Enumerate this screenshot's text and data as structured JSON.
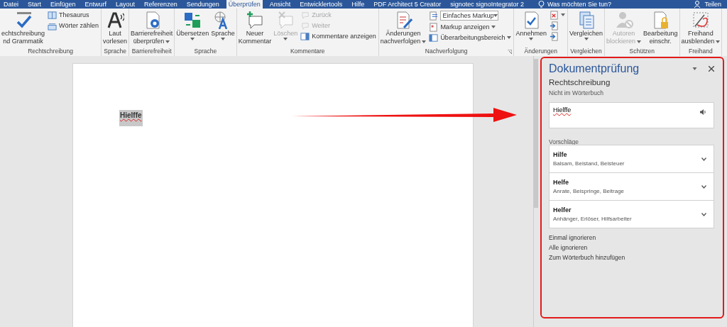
{
  "tabs": [
    {
      "label": "Datei",
      "selected": false
    },
    {
      "label": "Start",
      "selected": false
    },
    {
      "label": "Einfügen",
      "selected": false
    },
    {
      "label": "Entwurf",
      "selected": false
    },
    {
      "label": "Layout",
      "selected": false
    },
    {
      "label": "Referenzen",
      "selected": false
    },
    {
      "label": "Sendungen",
      "selected": false
    },
    {
      "label": "Überprüfen",
      "selected": true
    },
    {
      "label": "Ansicht",
      "selected": false
    },
    {
      "label": "Entwicklertools",
      "selected": false
    },
    {
      "label": "Hilfe",
      "selected": false
    },
    {
      "label": "PDF Architect 5 Creator",
      "selected": false
    },
    {
      "label": "signotec signoIntegrator 2",
      "selected": false
    }
  ],
  "tell_me": {
    "placeholder": "Was möchten Sie tun?"
  },
  "share": {
    "label": "Teilen"
  },
  "ribbon": {
    "groups": [
      {
        "label": "Rechtschreibung",
        "items": [
          {
            "kind": "large",
            "lines": [
              "echtschreibung",
              "nd Grammatik"
            ],
            "disabled": false,
            "dropdown": false
          },
          {
            "kind": "stack",
            "items": [
              {
                "label": "Thesaurus",
                "disabled": false,
                "dropdown": false
              },
              {
                "label": "Wörter zählen",
                "disabled": false,
                "dropdown": false
              }
            ]
          }
        ]
      },
      {
        "label": "Sprache",
        "items": [
          {
            "kind": "large",
            "lines": [
              "Laut",
              "vorlesen"
            ],
            "disabled": false,
            "dropdown": false
          }
        ]
      },
      {
        "label": "Barrierefreiheit",
        "items": [
          {
            "kind": "large",
            "lines": [
              "Barrierefreiheit",
              "überprüfen"
            ],
            "disabled": false,
            "dropdown": true
          }
        ]
      },
      {
        "label": "Sprache",
        "items": [
          {
            "kind": "large",
            "lines": [
              "Übersetzen"
            ],
            "disabled": false,
            "dropdown": true
          },
          {
            "kind": "large",
            "lines": [
              "Sprache"
            ],
            "disabled": false,
            "dropdown": true
          }
        ]
      },
      {
        "label": "Kommentare",
        "items": [
          {
            "kind": "large",
            "lines": [
              "Neuer",
              "Kommentar"
            ],
            "disabled": false,
            "dropdown": false
          },
          {
            "kind": "large",
            "lines": [
              "Löschen"
            ],
            "disabled": true,
            "dropdown": true
          },
          {
            "kind": "stack",
            "items": [
              {
                "label": "Zurück",
                "disabled": true,
                "dropdown": false
              },
              {
                "label": "Weiter",
                "disabled": true,
                "dropdown": false
              },
              {
                "label": "Kommentare anzeigen",
                "disabled": false,
                "dropdown": false
              }
            ]
          }
        ]
      },
      {
        "label": "Nachverfolgung",
        "launcher": true,
        "items": [
          {
            "kind": "large",
            "lines": [
              "Änderungen",
              "nachverfolgen"
            ],
            "disabled": false,
            "dropdown": true
          },
          {
            "kind": "stack",
            "items": [
              {
                "kind": "combo",
                "label": "Einfaches Markup",
                "dropdown": true
              },
              {
                "label": "Markup anzeigen",
                "disabled": false,
                "dropdown": true
              },
              {
                "label": "Überarbeitungsbereich",
                "disabled": false,
                "dropdown": true
              }
            ]
          }
        ]
      },
      {
        "label": "Änderungen",
        "items": [
          {
            "kind": "large",
            "lines": [
              "Annehmen"
            ],
            "disabled": false,
            "dropdown": true
          },
          {
            "kind": "stack",
            "items": [
              {
                "disabled": false,
                "dropdown": true
              },
              {
                "disabled": false,
                "dropdown": false
              },
              {
                "disabled": false,
                "dropdown": false
              }
            ]
          }
        ]
      },
      {
        "label": "Vergleichen",
        "items": [
          {
            "kind": "large",
            "lines": [
              "Vergleichen"
            ],
            "disabled": false,
            "dropdown": true
          }
        ]
      },
      {
        "label": "Schützen",
        "items": [
          {
            "kind": "large",
            "lines": [
              "Autoren",
              "blockieren"
            ],
            "disabled": true,
            "dropdown": true
          },
          {
            "kind": "large",
            "lines": [
              "Bearbeitung",
              "einschr."
            ],
            "disabled": false,
            "dropdown": false
          }
        ]
      },
      {
        "label": "Freihand",
        "items": [
          {
            "kind": "large",
            "lines": [
              "Freihand",
              "ausblenden"
            ],
            "disabled": false,
            "dropdown": true
          }
        ]
      }
    ]
  },
  "document": {
    "misspelled_word": "Hielffe"
  },
  "pane": {
    "title": "Dokumentprüfung",
    "section": "Rechtschreibung",
    "reason": "Nicht im Wörterbuch",
    "word": "Hielffe",
    "suggestions_label": "Vorschläge",
    "suggestions": [
      {
        "word": "Hilfe",
        "synonyms": "Balsam, Beistand, Beisteuer"
      },
      {
        "word": "Helfe",
        "synonyms": "Anrate, Beispringe, Beitrage"
      },
      {
        "word": "Helfer",
        "synonyms": "Anhänger, Erlöser, Hilfsarbeiter"
      }
    ],
    "actions": [
      "Einmal ignorieren",
      "Alle ignorieren",
      "Zum Wörterbuch hinzufügen"
    ]
  }
}
